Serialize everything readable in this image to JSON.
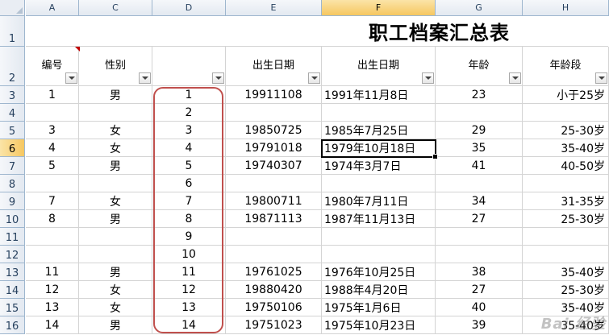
{
  "columns": [
    "A",
    "C",
    "D",
    "E",
    "F",
    "G",
    "H"
  ],
  "active_column": "F",
  "row_numbers": [
    "1",
    "2",
    "3",
    "4",
    "5",
    "6",
    "7",
    "8",
    "9",
    "10",
    "11",
    "12",
    "13",
    "14",
    "15",
    "16"
  ],
  "active_row": "6",
  "title": "职工档案汇总表",
  "headers": [
    "编号",
    "性别",
    "",
    "出生日期",
    "出生日期",
    "年龄",
    "年龄段"
  ],
  "rows": [
    [
      "1",
      "男",
      "1",
      "19911108",
      "1991年11月8日",
      "23",
      "小于25岁"
    ],
    [
      "",
      "",
      "2",
      "",
      "",
      "",
      ""
    ],
    [
      "3",
      "女",
      "3",
      "19850725",
      "1985年7月25日",
      "29",
      "25-30岁"
    ],
    [
      "4",
      "女",
      "4",
      "19791018",
      "1979年10月18日",
      "35",
      "35-40岁"
    ],
    [
      "5",
      "男",
      "5",
      "19740307",
      "1974年3月7日",
      "41",
      "40-50岁"
    ],
    [
      "",
      "",
      "6",
      "",
      "",
      "",
      ""
    ],
    [
      "7",
      "女",
      "7",
      "19800711",
      "1980年7月11日",
      "34",
      "31-35岁"
    ],
    [
      "8",
      "男",
      "8",
      "19871113",
      "1987年11月13日",
      "27",
      "25-30岁"
    ],
    [
      "",
      "",
      "9",
      "",
      "",
      "",
      ""
    ],
    [
      "",
      "",
      "10",
      "",
      "",
      "",
      ""
    ],
    [
      "11",
      "男",
      "11",
      "19761025",
      "1976年10月25日",
      "38",
      "35-40岁"
    ],
    [
      "12",
      "女",
      "12",
      "19880420",
      "1988年4月20日",
      "27",
      "25-30岁"
    ],
    [
      "13",
      "女",
      "13",
      "19750106",
      "1975年1月6日",
      "40",
      "35-40岁"
    ],
    [
      "14",
      "男",
      "14",
      "19751023",
      "1975年10月23日",
      "39",
      "35-40岁"
    ]
  ],
  "watermark": "Bai 经验",
  "colors": {
    "highlight_border": "#c0504d",
    "active_header": "#f6c760",
    "grid_line": "#d4d4d4"
  }
}
